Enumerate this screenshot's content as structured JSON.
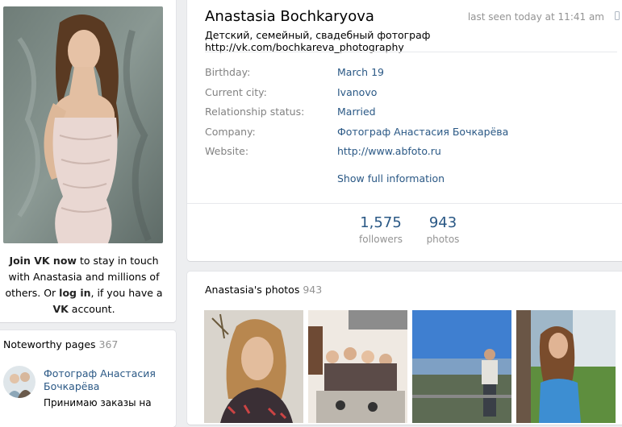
{
  "sidebar": {
    "join_prefix": "Join VK now",
    "join_mid": " to stay in touch with Anastasia and millions of others. Or ",
    "join_login": "log in",
    "join_mid2": ", if you have a ",
    "join_vk": "VK",
    "join_suffix": " account.",
    "noteworthy": {
      "title": "Noteworthy pages",
      "count": "367",
      "item_name": "Фотограф Анастасия Бочкарёва",
      "item_desc": "Принимаю заказы на"
    }
  },
  "profile": {
    "name": "Anastasia Bochkaryova",
    "last_seen": "last seen today at 11:41 am",
    "status": "Детский, семейный, свадебный фотограф http://vk.com/bochkareva_photography",
    "fields": [
      {
        "label": "Birthday:",
        "value": "March 19"
      },
      {
        "label": "Current city:",
        "value": "Ivanovo"
      },
      {
        "label": "Relationship status:",
        "value": "Married"
      },
      {
        "label": "Company:",
        "value": "Фотограф Анастасия Бочкарёва"
      },
      {
        "label": "Website:",
        "value": "http://www.abfoto.ru"
      }
    ],
    "show_full": "Show full information",
    "counters": [
      {
        "num": "1,575",
        "caption": "followers"
      },
      {
        "num": "943",
        "caption": "photos"
      }
    ]
  },
  "photos": {
    "title": "Anastasia's photos",
    "count": "943"
  },
  "colors": {
    "link": "#2a5885",
    "muted": "#939393",
    "page_bg": "#edeef0"
  }
}
